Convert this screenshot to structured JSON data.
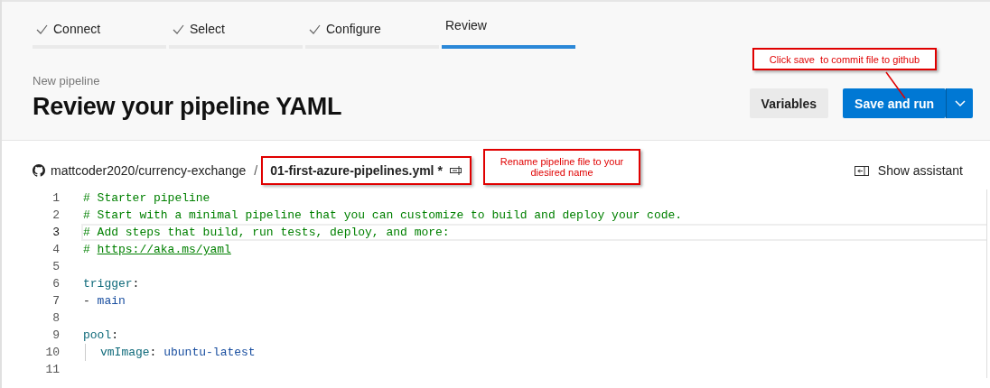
{
  "steps": [
    {
      "label": "Connect",
      "done": true,
      "selected": false
    },
    {
      "label": "Select",
      "done": true,
      "selected": false
    },
    {
      "label": "Configure",
      "done": true,
      "selected": false
    },
    {
      "label": "Review",
      "done": false,
      "selected": true
    }
  ],
  "header": {
    "breadcrumb": "New pipeline",
    "title": "Review your pipeline YAML",
    "buttons": [
      {
        "kind": "secondary",
        "label": "Variables"
      },
      {
        "kind": "primary",
        "label": "Save and run"
      }
    ]
  },
  "file_bar": {
    "repository": "mattcoder2020/currency-exchange",
    "separator": "/",
    "file_name": "01-first-azure-pipelines.yml *",
    "assistant": "Show assistant"
  },
  "editor": {
    "lines": [
      {
        "number": "1",
        "current": false,
        "tokens": [
          {
            "kind": "comment",
            "text": "# Starter pipeline"
          }
        ]
      },
      {
        "number": "2",
        "current": false,
        "tokens": [
          {
            "kind": "comment",
            "text": "# Start with a minimal pipeline that you can customize to build and deploy your code."
          }
        ]
      },
      {
        "number": "3",
        "current": true,
        "tokens": [
          {
            "kind": "comment",
            "text": "# Add steps that build, run tests, deploy, and more:"
          }
        ]
      },
      {
        "number": "4",
        "current": false,
        "tokens": [
          {
            "kind": "comment",
            "text": "# "
          },
          {
            "kind": "link",
            "text": "https://aka.ms/yaml"
          }
        ]
      },
      {
        "number": "5",
        "current": false
      },
      {
        "number": "6",
        "current": false,
        "tokens": [
          {
            "kind": "key",
            "text": "trigger"
          },
          {
            "kind": "plain",
            "text": ":"
          }
        ]
      },
      {
        "number": "7",
        "current": false,
        "tokens": [
          {
            "kind": "plain",
            "text": "- "
          },
          {
            "kind": "value",
            "text": "main"
          }
        ]
      },
      {
        "number": "8",
        "current": false
      },
      {
        "number": "9",
        "current": false,
        "tokens": [
          {
            "kind": "key",
            "text": "pool"
          },
          {
            "kind": "plain",
            "text": ":"
          }
        ]
      },
      {
        "number": "10",
        "current": false,
        "indent_guide": true,
        "tokens": [
          {
            "kind": "key",
            "text": "vmImage"
          },
          {
            "kind": "plain",
            "text": ": "
          },
          {
            "kind": "value",
            "text": "ubuntu-latest"
          }
        ]
      },
      {
        "number": "11",
        "current": false
      }
    ]
  },
  "annotations": [
    {
      "kind": "arrow-note",
      "text": "Click save  to commit file to github"
    },
    {
      "kind": "note",
      "text": "Rename pipeline file to your diesired name"
    }
  ]
}
